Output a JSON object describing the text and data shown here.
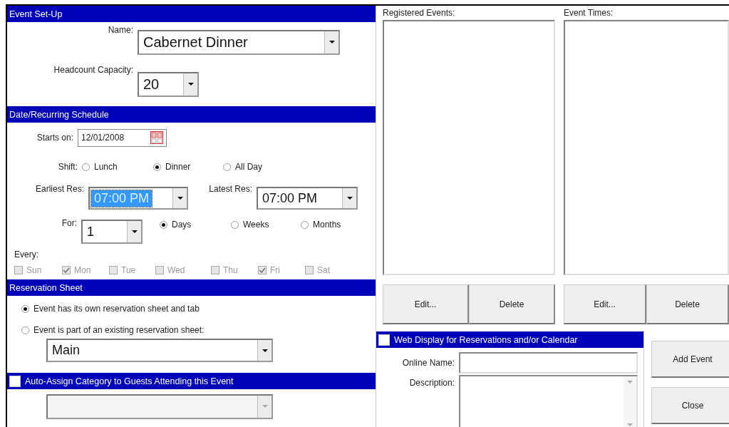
{
  "event_setup": {
    "title": "Event Set-Up",
    "name": {
      "label": "Name:",
      "value": "Cabernet Dinner"
    },
    "headcount": {
      "label": "Headcount Capacity:",
      "value": "20"
    }
  },
  "schedule": {
    "title": "Date/Recurring Schedule",
    "starts_on": {
      "label": "Starts on:",
      "value": "12/01/2008"
    },
    "shift": {
      "label": "Shift:",
      "options": [
        {
          "label": "Lunch",
          "selected": false
        },
        {
          "label": "Dinner",
          "selected": true
        },
        {
          "label": "All Day",
          "selected": false
        }
      ]
    },
    "earliest": {
      "label": "Earliest Res:",
      "value": "07:00 PM",
      "focused": true
    },
    "latest": {
      "label": "Latest Res:",
      "value": "07:00 PM",
      "focused": false
    },
    "for": {
      "label": "For:",
      "value": "1",
      "units": [
        {
          "label": "Days",
          "selected": true
        },
        {
          "label": "Weeks",
          "selected": false
        },
        {
          "label": "Months",
          "selected": false
        }
      ]
    },
    "every": {
      "label": "Every:",
      "days": [
        {
          "label": "Sun",
          "checked": false,
          "disabled": true
        },
        {
          "label": "Mon",
          "checked": true,
          "disabled": true
        },
        {
          "label": "Tue",
          "checked": false,
          "disabled": true
        },
        {
          "label": "Wed",
          "checked": false,
          "disabled": true
        },
        {
          "label": "Thu",
          "checked": false,
          "disabled": true
        },
        {
          "label": "Fri",
          "checked": true,
          "disabled": true
        },
        {
          "label": "Sat",
          "checked": false,
          "disabled": true
        }
      ]
    }
  },
  "reservation_sheet": {
    "title": "Reservation Sheet",
    "options": [
      {
        "label": "Event has its own reservation sheet and tab",
        "selected": true
      },
      {
        "label": "Event is part of an existing reservation sheet:",
        "selected": false
      }
    ],
    "sheet": {
      "value": "Main"
    }
  },
  "auto_assign": {
    "title": "Auto-Assign Category to Guests Attending this Event",
    "checked": false,
    "category": {
      "disabled": true
    }
  },
  "lists": [
    {
      "label": "Registered Events:",
      "buttons": [
        "Edit...",
        "Delete"
      ]
    },
    {
      "label": "Event Times:",
      "buttons": [
        "Edit...",
        "Delete"
      ]
    }
  ],
  "web_display": {
    "title": "Web Display for Reservations and/or Calendar",
    "checked": false,
    "fields": [
      {
        "label": "Online Name:",
        "kind": "text"
      },
      {
        "label": "Description:",
        "kind": "textarea"
      }
    ]
  },
  "actions": [
    "Add Event",
    "Close"
  ]
}
